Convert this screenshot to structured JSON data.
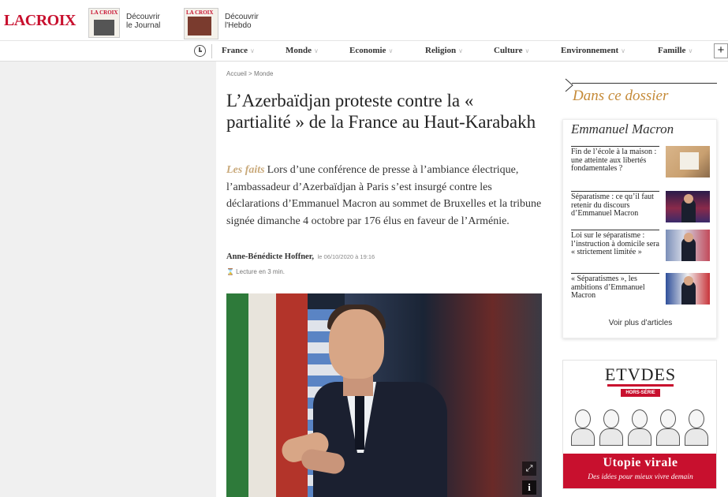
{
  "header": {
    "logo": "LACROIX",
    "promos": [
      {
        "masthead": "LA CROIX",
        "label": "Découvrir le Journal"
      },
      {
        "masthead": "LA CROIX",
        "label": "Découvrir l'Hebdo"
      }
    ]
  },
  "nav": {
    "items": [
      "France",
      "Monde",
      "Economie",
      "Religion",
      "Culture",
      "Environnement",
      "Famille"
    ],
    "chevron": "∨",
    "plus": "+"
  },
  "article": {
    "breadcrumb": [
      "Accueil",
      ">",
      "Monde"
    ],
    "title": "L’Azerbaïdjan proteste contre la « partialité » de la France au Haut-Karabakh",
    "lede_tag": "Les faits",
    "lede": "Lors d’une conférence de presse à l’ambiance électrique, l’ambassadeur d’Azerbaïdjan à Paris s’est insurgé contre les déclarations d’Emmanuel Macron au sommet de Bruxelles et la tribune signée dimanche 4  octobre par 176 élus en faveur de l’Arménie.",
    "author": "Anne-Bénédicte Hoffner,",
    "date": "le 06/10/2020 à 19:16",
    "reading_time": "⌛ Lecture en 3 min."
  },
  "photo": {
    "expand_icon": "⤢",
    "info_icon": "i"
  },
  "dossier": {
    "section_label": "Dans ce dossier",
    "title": "Emmanuel Macron",
    "items": [
      {
        "text": "Fin de l’école à la maison : une atteinte aux libertés fondamentales ?"
      },
      {
        "text": "Séparatisme : ce qu’il faut retenir du discours d’Emmanuel Macron"
      },
      {
        "text": "Loi sur le séparatisme : l’instruction à domicile sera « strictement limitée »"
      },
      {
        "text": "« Séparatismes », les ambitions d’Emmanuel Macron"
      }
    ],
    "more": "Voir plus d’articles"
  },
  "ad": {
    "brand": "ETVDES",
    "badge": "HORS-SÉRIE",
    "headline": "Utopie virale",
    "subline": "Des idées pour mieux vivre demain"
  },
  "colors": {
    "brand_red": "#c8102e",
    "dossier_gold": "#c58a38",
    "lede_tag_gold": "#c9a97a"
  }
}
